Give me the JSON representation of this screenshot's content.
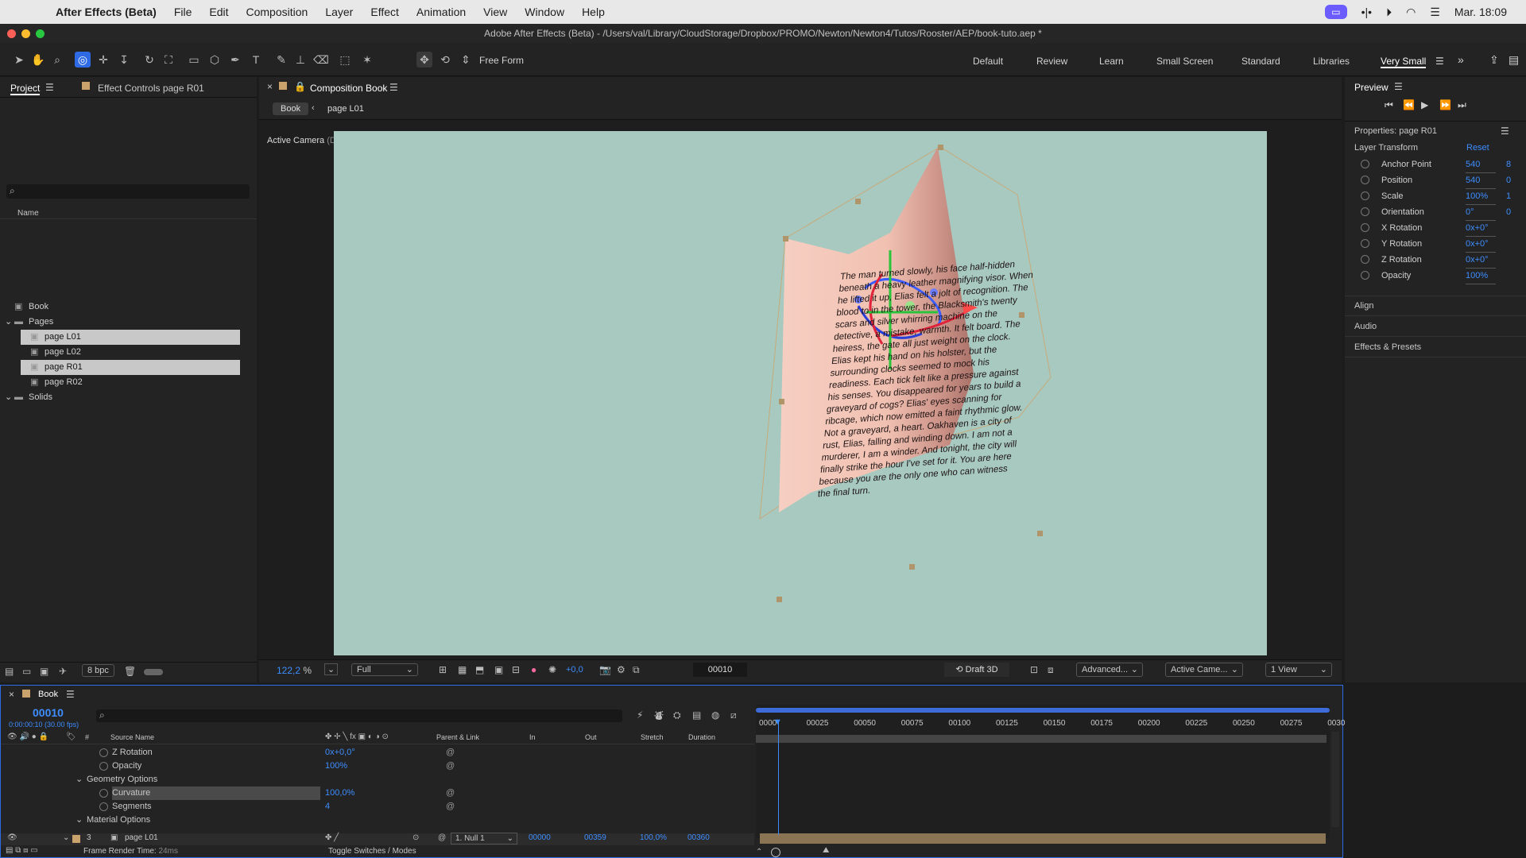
{
  "menubar": {
    "app": "After Effects (Beta)",
    "items": [
      "File",
      "Edit",
      "Composition",
      "Layer",
      "Effect",
      "Animation",
      "View",
      "Window",
      "Help"
    ],
    "clock": "Mar. 18:09"
  },
  "window": {
    "title": "Adobe After Effects (Beta) - /Users/val/Library/CloudStorage/Dropbox/PROMO/Newton/Newton4/Tutos/Rooster/AEP/book-tuto.aep *"
  },
  "toolbar": {
    "free_form": "Free Form",
    "workspaces": [
      "Default",
      "Review",
      "Learn",
      "Small Screen",
      "Standard",
      "Libraries",
      "Very Small"
    ]
  },
  "project": {
    "tab_project": "Project",
    "tab_effect": "Effect Controls page R01",
    "col_name": "Name",
    "depth": "8 bpc",
    "items": [
      {
        "label": "Book",
        "level": 0,
        "folder": false,
        "selected": false
      },
      {
        "label": "Pages",
        "level": 0,
        "folder": true,
        "selected": false
      },
      {
        "label": "page L01",
        "level": 1,
        "folder": false,
        "selected": true
      },
      {
        "label": "page L02",
        "level": 1,
        "folder": false,
        "selected": false
      },
      {
        "label": "page R01",
        "level": 1,
        "folder": false,
        "selected": true
      },
      {
        "label": "page R02",
        "level": 1,
        "folder": false,
        "selected": false
      },
      {
        "label": "Solids",
        "level": 0,
        "folder": true,
        "selected": false
      }
    ]
  },
  "comp": {
    "tab": "Composition Book",
    "crumb_root": "Book",
    "crumb_child": "page L01",
    "active_camera": "Active Camera",
    "camera_default": "(Default)",
    "page_text": "The man turned slowly, his face half-hidden beneath a heavy leather magnifying visor. When he lifted it up, Elias felt a jolt of recognition. The blood to in the tower, the Blacksmith's twenty scars and silver whirring machine on the detective, a mistake, warmth. It felt board. The heiress, the gate all just weight on the clock. Elias kept his hand on his holster, but the surrounding clocks seemed to mock his readiness. Each tick felt like a pressure against his senses. You disappeared for years to build a graveyard of cogs? Elias' eyes scanning for ribcage, which now emitted a faint rhythmic glow. Not a graveyard, a heart. Oakhaven is a city of rust, Elias, falling and winding down. I am not a murderer, I am a winder. And tonight, the city will finally strike the hour I've set for it. You are here because you are the only one who can witness the final turn.",
    "zoom": "122,2",
    "zoom_unit": "%",
    "resolution": "Full",
    "exposure": "+0,0",
    "timecode": "00010",
    "renderer": "Draft 3D",
    "advanced": "Advanced...",
    "camera_select": "Active Came...",
    "view": "1 View"
  },
  "preview": {
    "title": "Preview"
  },
  "properties": {
    "title": "Properties: page R01",
    "section": "Layer Transform",
    "reset": "Reset",
    "rows": [
      {
        "label": "Anchor Point",
        "v1": "540",
        "v2": "8"
      },
      {
        "label": "Position",
        "v1": "540",
        "v2": "0"
      },
      {
        "label": "Scale",
        "v1": "100%",
        "v2": "1"
      },
      {
        "label": "Orientation",
        "v1": "0°",
        "v2": "0"
      },
      {
        "label": "X Rotation",
        "v1": "0x+0°",
        "v2": ""
      },
      {
        "label": "Y Rotation",
        "v1": "0x+0°",
        "v2": ""
      },
      {
        "label": "Z Rotation",
        "v1": "0x+0°",
        "v2": ""
      },
      {
        "label": "Opacity",
        "v1": "100%",
        "v2": ""
      }
    ],
    "panels": [
      "Align",
      "Audio",
      "Effects & Presets"
    ]
  },
  "timeline": {
    "tab": "Book",
    "timecode": "00010",
    "timecode_sub": "0:00:00:10 (30.00 fps)",
    "cols": {
      "hash": "#",
      "source": "Source Name",
      "parent": "Parent & Link",
      "in": "In",
      "out": "Out",
      "stretch": "Stretch",
      "duration": "Duration"
    },
    "rows": [
      {
        "label": "Z Rotation",
        "value": "0x+0,0°",
        "indent": 2
      },
      {
        "label": "Opacity",
        "value": "100%",
        "indent": 2
      },
      {
        "label": "Geometry Options",
        "value": "",
        "indent": 1
      },
      {
        "label": "Curvature",
        "value": "100,0%",
        "indent": 2
      },
      {
        "label": "Segments",
        "value": "4",
        "indent": 2
      },
      {
        "label": "Material Options",
        "value": "",
        "indent": 1
      }
    ],
    "layer": {
      "num": "3",
      "name": "page L01",
      "parent": "1. Null 1",
      "in": "00000",
      "out": "00359",
      "stretch": "100,0%",
      "duration": "00360"
    },
    "ruler": [
      "0000",
      "00025",
      "00050",
      "00075",
      "00100",
      "00125",
      "00150",
      "00175",
      "00200",
      "00225",
      "00250",
      "00275",
      "0030"
    ],
    "footer_left": "Frame Render Time:",
    "render_time": "24ms",
    "footer_mid": "Toggle Switches / Modes"
  }
}
